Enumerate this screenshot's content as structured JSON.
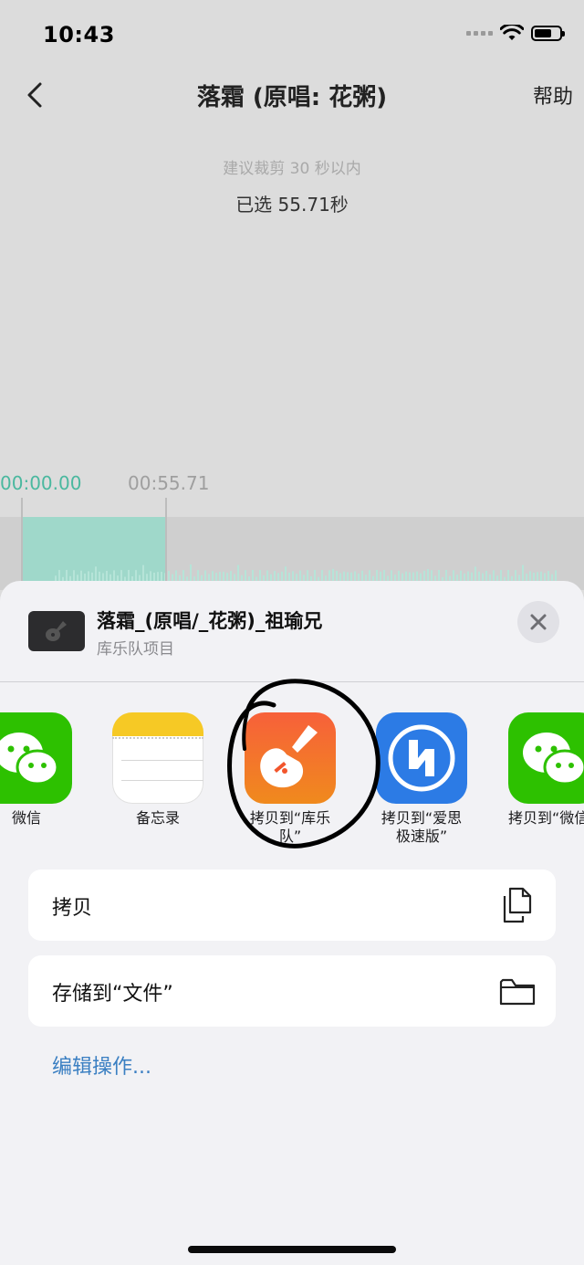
{
  "status_bar": {
    "time": "10:43"
  },
  "nav": {
    "title": "落霜 (原唱: 花粥)",
    "help": "帮助"
  },
  "editor": {
    "hint": "建议裁剪 30 秒以内",
    "selected": "已选 55.71秒",
    "start_time": "00:00.00",
    "end_time": "00:55.71"
  },
  "share": {
    "file_name": "落霜_(原唱/_花粥)_祖瑜兄",
    "file_type": "库乐队项目",
    "apps": [
      {
        "label": "微信",
        "icon": "wechat-icon"
      },
      {
        "label": "备忘录",
        "icon": "notes-icon"
      },
      {
        "label": "拷贝到“库乐队”",
        "icon": "garageband-icon"
      },
      {
        "label": "拷贝到“爱思极速版”",
        "icon": "i4-icon"
      },
      {
        "label": "拷贝到“微信”",
        "icon": "wechat-icon"
      }
    ],
    "actions": [
      {
        "label": "拷贝",
        "icon": "copy-icon"
      },
      {
        "label": "存储到“文件”",
        "icon": "folder-icon"
      }
    ],
    "edit_actions": "编辑操作..."
  },
  "colors": {
    "selection": "#9fd8ca",
    "time_accent": "#4ab89f",
    "link": "#3a7fc2",
    "wechat": "#2dc100",
    "garageband": "#f2552c",
    "i4": "#2c7be5"
  }
}
